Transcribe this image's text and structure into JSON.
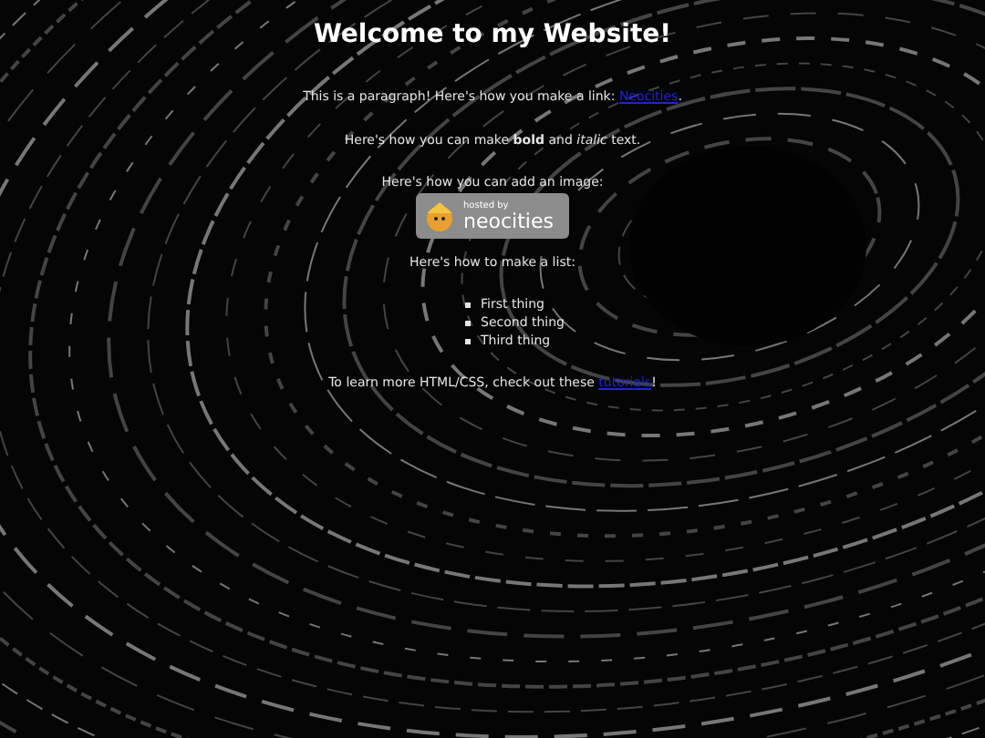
{
  "title": "Welcome to my Website!",
  "link_paragraph": {
    "text": "This is a paragraph! Here's how you make a link:",
    "link": "Neocities",
    "after": "."
  },
  "format_paragraph": "Here's how you can make **bold** and *italic* text.",
  "image_paragraph": "Here's how you can add an image:",
  "badge": {
    "caption": "hosted by",
    "name": "neocities"
  },
  "list_paragraph": "Here's how to make a list:",
  "list": [
    "First thing",
    "Second thing",
    "Third thing"
  ],
  "footer": {
    "text": "To learn more HTML/CSS, check out these",
    "link": "tutorials",
    "after": "!"
  }
}
